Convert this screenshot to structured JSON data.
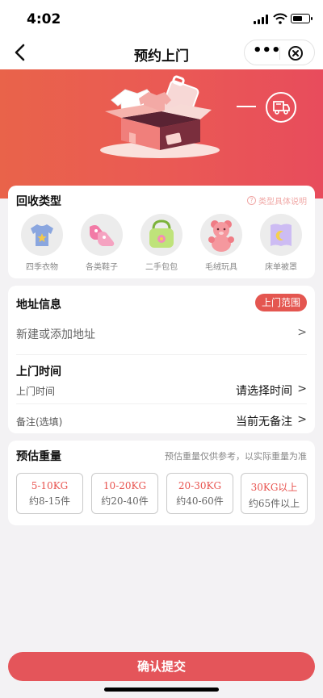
{
  "status_bar": {
    "time": "4:02"
  },
  "nav": {
    "title": "预约上门",
    "more": "•••"
  },
  "recycle_type": {
    "title": "回收类型",
    "help": "类型具体说明",
    "items": [
      {
        "label": "四季衣物",
        "icon": "tshirt-icon"
      },
      {
        "label": "各类鞋子",
        "icon": "shoes-icon"
      },
      {
        "label": "二手包包",
        "icon": "bag-icon"
      },
      {
        "label": "毛绒玩具",
        "icon": "teddy-bear-icon"
      },
      {
        "label": "床单被罩",
        "icon": "bedding-icon"
      }
    ]
  },
  "address": {
    "title": "地址信息",
    "range_button": "上门范围",
    "placeholder": "新建或添加地址",
    "arrow": ">"
  },
  "visit_time": {
    "title": "上门时间",
    "time_label": "上门时间",
    "time_value": "请选择时间",
    "note_label": "备注(选填)",
    "note_value": "当前无备注"
  },
  "weight": {
    "title": "预估重量",
    "hint": "预估重量仅供参考，以实际重量为准",
    "options": [
      {
        "weight": "5-10KG",
        "count": "约8-15件"
      },
      {
        "weight": "10-20KG",
        "count": "约20-40件"
      },
      {
        "weight": "20-30KG",
        "count": "约40-60件"
      },
      {
        "weight": "30KG以上",
        "count": "约65件以上"
      }
    ]
  },
  "submit_label": "确认提交",
  "colors": {
    "accent": "#e4555a",
    "banner_start": "#e9634a",
    "banner_end": "#e84c5c"
  }
}
